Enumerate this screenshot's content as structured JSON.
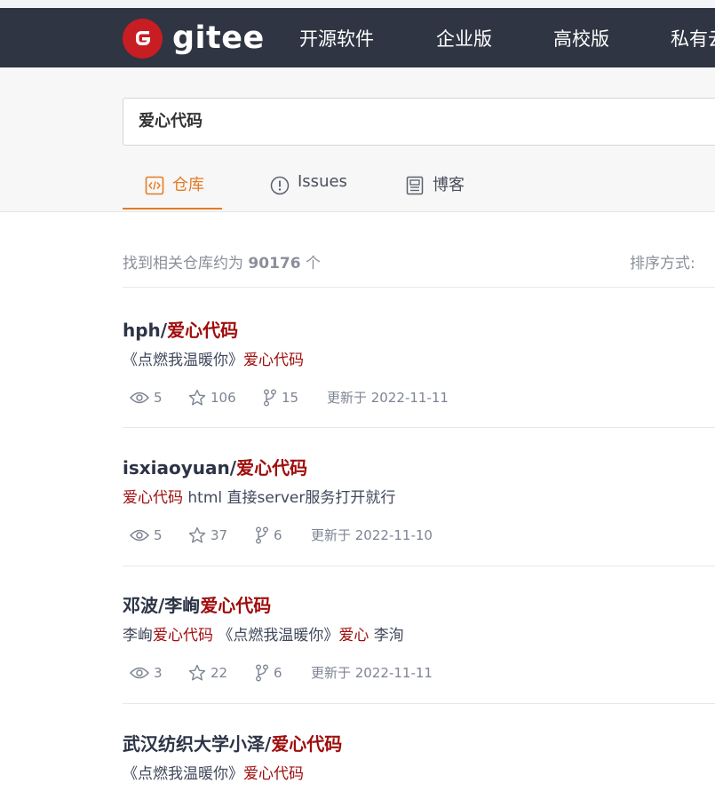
{
  "header": {
    "logo_text": "gitee",
    "nav": [
      "开源软件",
      "企业版",
      "高校版",
      "私有云"
    ]
  },
  "search": {
    "query": "爱心代码"
  },
  "tabs": [
    {
      "label": "仓库",
      "icon": "code-icon",
      "active": true
    },
    {
      "label": "Issues",
      "icon": "issue-icon",
      "active": false
    },
    {
      "label": "博客",
      "icon": "blog-icon",
      "active": false
    }
  ],
  "summary": {
    "prefix": "找到相关仓库约为",
    "count": "90176",
    "suffix": "个",
    "sort_label": "排序方式:"
  },
  "repos": [
    {
      "owner": "hph/",
      "name": "爱心代码",
      "desc": [
        {
          "t": "《点燃我温暖你》",
          "hl": false
        },
        {
          "t": "爱心代码",
          "hl": true
        }
      ],
      "watch": "5",
      "star": "106",
      "fork": "15",
      "updated": "更新于 2022-11-11"
    },
    {
      "owner": "isxiaoyuan/",
      "name": "爱心代码",
      "desc": [
        {
          "t": "爱心代码",
          "hl": true
        },
        {
          "t": " html 直接server服务打开就行",
          "hl": false
        }
      ],
      "watch": "5",
      "star": "37",
      "fork": "6",
      "updated": "更新于 2022-11-10"
    },
    {
      "owner": "邓波/李峋",
      "name": "爱心代码",
      "desc": [
        {
          "t": "李峋",
          "hl": false
        },
        {
          "t": "爱心代码",
          "hl": true
        },
        {
          "t": " 《点燃我温暖你》",
          "hl": false
        },
        {
          "t": "爱心",
          "hl": true
        },
        {
          "t": " 李洵",
          "hl": false
        }
      ],
      "watch": "3",
      "star": "22",
      "fork": "6",
      "updated": "更新于 2022-11-11"
    },
    {
      "owner": "武汉纺织大学小泽/",
      "name": "爱心代码",
      "desc": [
        {
          "t": "《点燃我温暖你》",
          "hl": false
        },
        {
          "t": "爱心代码",
          "hl": true
        }
      ]
    }
  ],
  "colors": {
    "nav_bg": "#2f3542",
    "brand_red": "#c71d23",
    "accent_orange": "#e57a24",
    "highlight": "#a00d0d"
  }
}
